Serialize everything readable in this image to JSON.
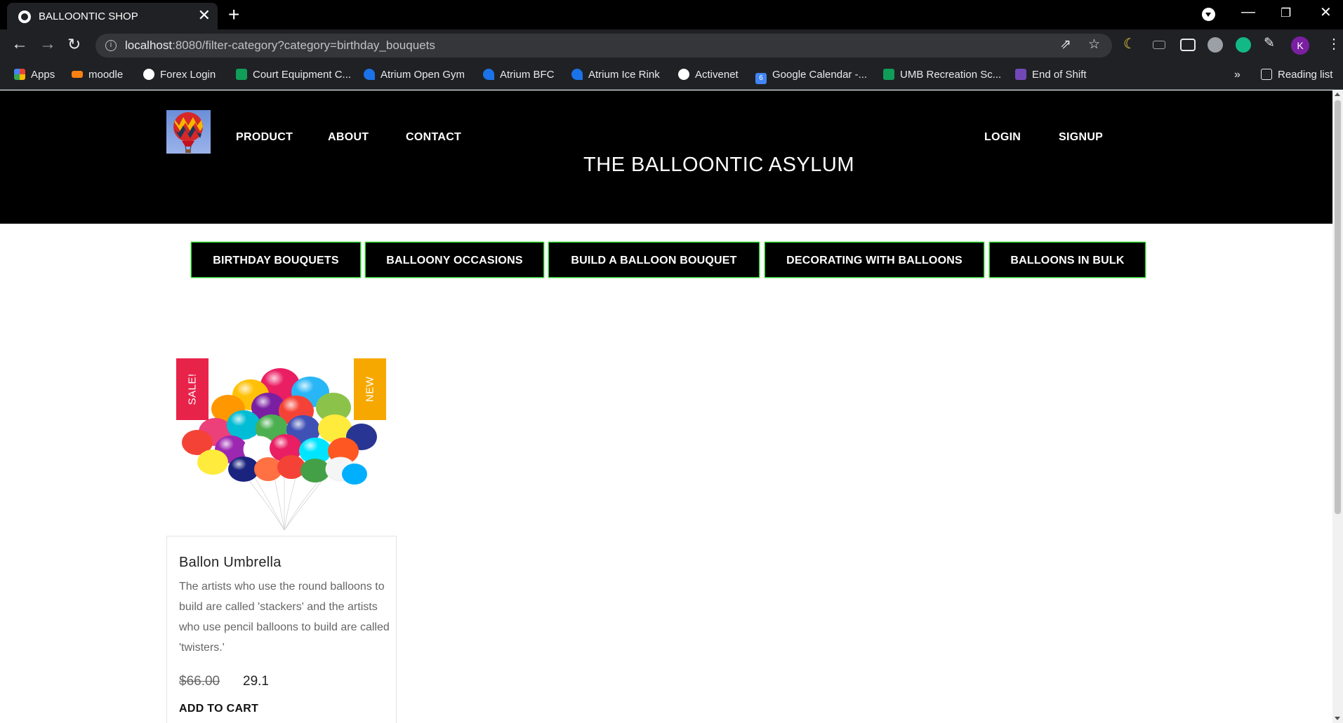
{
  "browser": {
    "tab_title": "BALLOONTIC SHOP",
    "tab_close": "✕",
    "new_tab": "+",
    "url_host": "localhost",
    "url_rest": ":8080/filter-category?category=birthday_bouquets",
    "profile_initial": "K",
    "bookmarks": [
      {
        "label": "Apps",
        "icon": "apps-grid-icon",
        "color": "#4285f4"
      },
      {
        "label": "moodle",
        "icon": "moodle-icon",
        "color": "#f98012"
      },
      {
        "label": "Forex Login",
        "icon": "globe-icon",
        "color": "#ffffff"
      },
      {
        "label": "Court Equipment C...",
        "icon": "sheets-icon",
        "color": "#0f9d58"
      },
      {
        "label": "Atrium Open Gym",
        "icon": "atrium-icon",
        "color": "#1a73e8"
      },
      {
        "label": "Atrium BFC",
        "icon": "atrium-icon",
        "color": "#1a73e8"
      },
      {
        "label": "Atrium Ice Rink",
        "icon": "atrium-icon",
        "color": "#1a73e8"
      },
      {
        "label": "Activenet",
        "icon": "globe-icon",
        "color": "#ffffff"
      },
      {
        "label": "Google Calendar -...",
        "icon": "calendar-icon",
        "color": "#4285f4"
      },
      {
        "label": "UMB Recreation Sc...",
        "icon": "sheets-icon",
        "color": "#0f9d58"
      },
      {
        "label": "End of Shift",
        "icon": "forms-icon",
        "color": "#7248b9"
      }
    ],
    "bookmarks_overflow": "»",
    "reading_list": "Reading list"
  },
  "site": {
    "nav": {
      "product": "PRODUCT",
      "about": "ABOUT",
      "contact": "CONTACT",
      "login": "LOGIN",
      "signup": "SIGNUP"
    },
    "title": "THE BALLOONTIC ASYLUM",
    "categories": [
      "BIRTHDAY BOUQUETS",
      "BALLOONY OCCASIONS",
      "BUILD A BALLOON BOUQUET",
      "DECORATING WITH BALLOONS",
      "BALLOONS IN BULK"
    ],
    "accent_color": "#1fd11f"
  },
  "products": [
    {
      "name": "Ballon Umbrella",
      "description": "The artists who use the round balloons to build are called 'stackers' and the artists who use pencil balloons to build are called 'twisters.'",
      "old_price": "$66.00",
      "price": "29.1",
      "badge_sale": "SALE!",
      "badge_new": "NEW",
      "sale_color": "#e8234a",
      "new_color": "#f7a800",
      "add_to_cart": "ADD TO CART"
    }
  ]
}
